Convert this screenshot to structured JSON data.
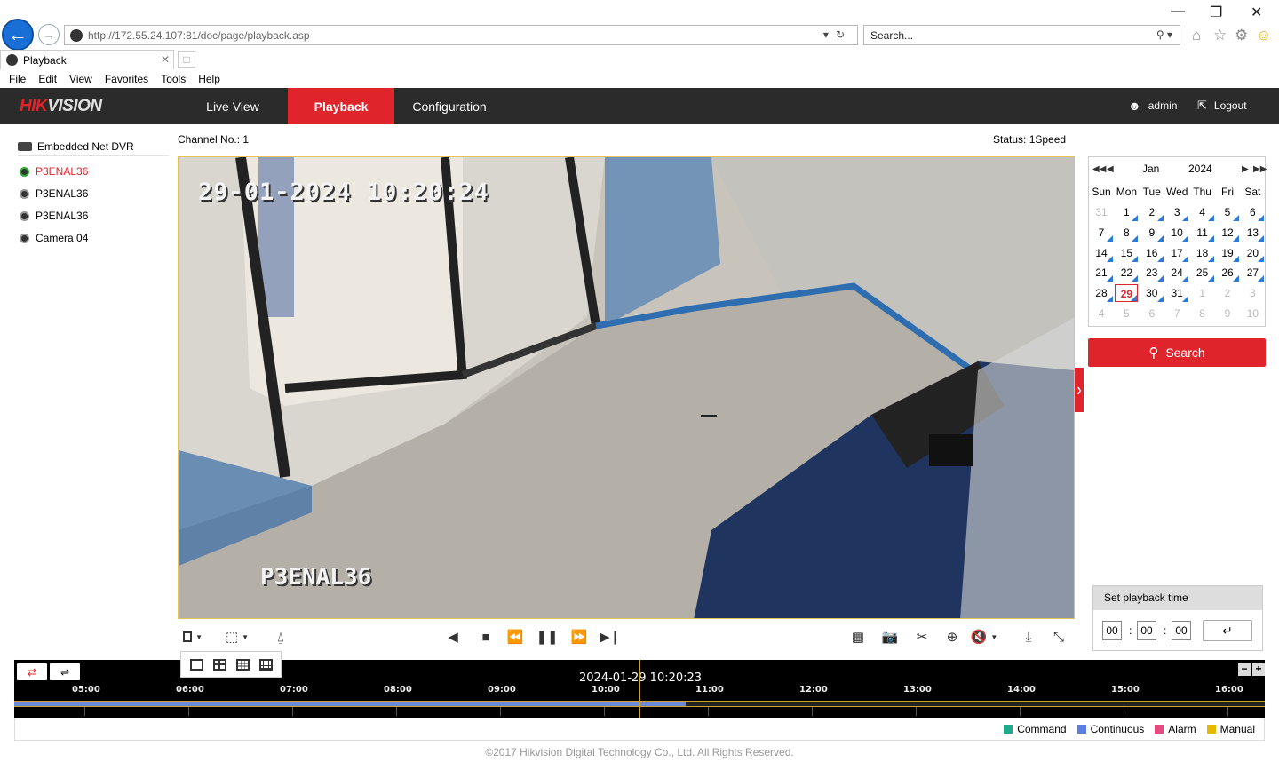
{
  "browser": {
    "url_host": "http://172.55.24.107",
    "url_port_path": ":81/doc/page/playback.asp",
    "search_placeholder": "Search...",
    "tab_title": "Playback",
    "menu": [
      "File",
      "Edit",
      "View",
      "Favorites",
      "Tools",
      "Help"
    ]
  },
  "app": {
    "logo_red": "HIK",
    "logo_rest": "VISION",
    "nav": {
      "live": "Live View",
      "playback": "Playback",
      "config": "Configuration"
    },
    "user": "admin",
    "logout": "Logout"
  },
  "tree": {
    "root": "Embedded Net DVR",
    "cameras": [
      "P3ENAL36",
      "P3ENAL36",
      "P3ENAL36",
      "Camera 04"
    ],
    "active_index": 0
  },
  "video": {
    "channel_label": "Channel No.: 1",
    "status_label": "Status: 1Speed",
    "osd_time": "29-01-2024 10:20:24",
    "osd_name": "P3ENAL36"
  },
  "calendar": {
    "month": "Jan",
    "year": "2024",
    "weekdays": [
      "Sun",
      "Mon",
      "Tue",
      "Wed",
      "Thu",
      "Fri",
      "Sat"
    ],
    "selected_day": "29",
    "search_label": "Search"
  },
  "playback_time": {
    "title": "Set playback time",
    "hh": "00",
    "mm": "00",
    "ss": "00"
  },
  "timeline": {
    "current": "2024-01-29 10:20:23",
    "ticks": [
      "05:00",
      "06:00",
      "07:00",
      "08:00",
      "09:00",
      "10:00",
      "11:00",
      "12:00",
      "13:00",
      "14:00",
      "15:00",
      "16:00"
    ],
    "recorded_until_fraction": 0.537,
    "legend": [
      {
        "label": "Command",
        "color": "#1faa8c"
      },
      {
        "label": "Continuous",
        "color": "#5b7fe0"
      },
      {
        "label": "Alarm",
        "color": "#e84a7f"
      },
      {
        "label": "Manual",
        "color": "#e6b800"
      }
    ]
  },
  "footer": "©2017 Hikvision Digital Technology Co., Ltd. All Rights Reserved."
}
